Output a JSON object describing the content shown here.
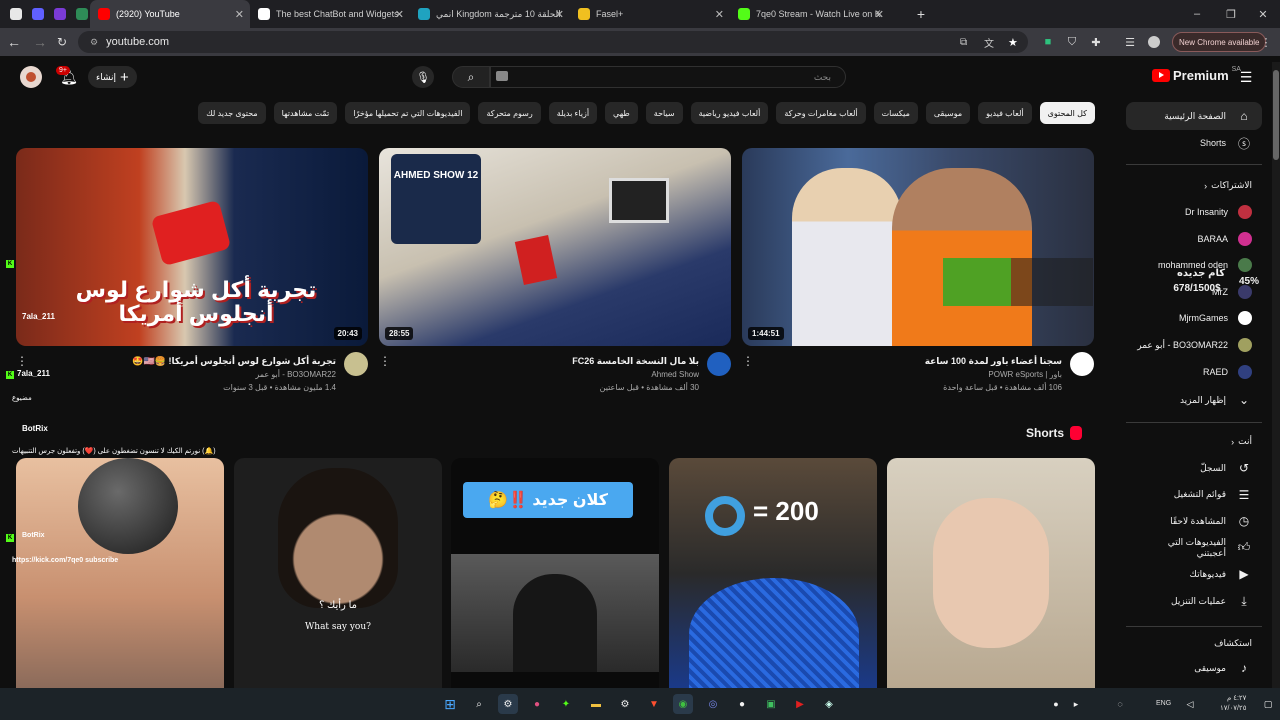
{
  "browser": {
    "tabs": [
      {
        "title": "",
        "color": "#e8e8e8"
      },
      {
        "title": "",
        "color": "#6060ff"
      },
      {
        "title": "",
        "color": "#7a3bd6"
      },
      {
        "title": "",
        "color": "#2e8b57"
      },
      {
        "title": "(2920) YouTube",
        "color": "#ff0000"
      },
      {
        "title": "The best ChatBot and Widgets",
        "color": "#ffffff"
      },
      {
        "title": "انمي Kingdom الحلقة 10 مترجمة",
        "color": "#1fa3c0"
      },
      {
        "title": "Fasel+",
        "color": "#f0c020"
      },
      {
        "title": "7qe0 Stream - Watch Live on K",
        "color": "#53fc18"
      }
    ],
    "new_tab": "+",
    "minimize": "–",
    "restore": "❐",
    "close": "✕",
    "url": "youtube.com",
    "new_chrome_label": "New Chrome available"
  },
  "youtube": {
    "notif_count": "9+",
    "create_label": "إنشاء",
    "search_placeholder": "بحث",
    "logo": "Premium",
    "region": "SA",
    "chips": [
      "كل المحتوى",
      "ألعاب فيديو",
      "موسيقى",
      "ميكسات",
      "ألعاب مغامرات وحركة",
      "ألعاب فيديو رياضية",
      "سياحة",
      "طهي",
      "أزياء بديلة",
      "رسوم متحركة",
      "الفيديوهات التي تم تحميلها مؤخرًا",
      "تمّت مشاهدتها",
      "محتوى جديد لك"
    ],
    "sidebar": {
      "home": "الصفحة الرئيسية",
      "shorts": "Shorts",
      "subs_header": "الاشتراكات",
      "subs": [
        {
          "name": "Dr Insanity",
          "color": "#c03040"
        },
        {
          "name": "BARAA",
          "color": "#d03090"
        },
        {
          "name": "mohammed oden",
          "color": "#4a7a4a"
        },
        {
          "name": "MrZ",
          "color": "#3a3a6a"
        },
        {
          "name": "MjrmGames",
          "color": "#ffffff"
        },
        {
          "name": "BO3OMAR22 - أبو عمر",
          "color": "#a0a060"
        },
        {
          "name": "RAED",
          "color": "#304080"
        }
      ],
      "show_more": "إظهار المزيد",
      "you_header": "أنت",
      "you": [
        {
          "label": "السجلّ",
          "icon": "history-icon"
        },
        {
          "label": "قوائم التشغيل",
          "icon": "playlist-icon"
        },
        {
          "label": "المشاهدة لاحقًا",
          "icon": "clock-icon"
        },
        {
          "label": "الفيديوهات التي أعجبتني",
          "icon": "like-icon"
        },
        {
          "label": "فيديوهاتك",
          "icon": "video-icon"
        },
        {
          "label": "عمليات التنزيل",
          "icon": "download-icon"
        }
      ],
      "explore_header": "استكشاف",
      "music": "موسيقى"
    },
    "videos": [
      {
        "title": "تجربة أكل شوارع لوس أنجلوس أمريكا! 🍔🇺🇸🤩",
        "channel": "BO3OMAR22 - أبو عمر",
        "meta": "1.4 مليون مشاهدة • قبل 3 سنوات",
        "duration": "20:43",
        "thumb_text": "تجربة أكل شوارع لوس أنجلوس أمريكا",
        "avatar": "#c8c090"
      },
      {
        "title": "بلا مال النسخة الخامسة FC26",
        "channel": "Ahmed Show",
        "meta": "30 ألف مشاهدة • قبل ساعتين",
        "duration": "28:55",
        "thumb_text": "AHMED SHOW 12",
        "avatar": "#2060c0"
      },
      {
        "title": "سجنا أعضاء باور لمدة 100 ساعة",
        "channel": "باور | POWR eSports",
        "meta": "106 ألف مشاهدة • قبل ساعة واحدة",
        "duration": "1:44:51",
        "thumb_text": "",
        "avatar": "#ffffff"
      }
    ],
    "shorts_label": "Shorts",
    "shorts": [
      {
        "text": "",
        "bg": "#c89070"
      },
      {
        "text": "ما رأيك ؟",
        "sub": "What say you?",
        "bg": "#2a2a2a"
      },
      {
        "text": "كلان جديد ‼️🤔",
        "bg": "#0a0a0a"
      },
      {
        "text": "= 200",
        "bg": "#3a3a3a"
      },
      {
        "text": "",
        "bg": "#c8b8a0"
      }
    ]
  },
  "overlay": {
    "kick_user": "7ala_211",
    "kick_user2": "7ala_211",
    "msg1": "مضيوع",
    "botrix": "BotRix",
    "botrix_msg": "(🔔) نورتم الكيك لا تنسون تضغطون على (❤️) وتفعلون جرس التنبيهات",
    "botrix2": "BotRix",
    "kick_link": "https://kick.com/7qe0 subscribe",
    "goal_title": "كام جديده",
    "goal_value": "678/1500$",
    "goal_percent": "45%",
    "goal_fill": 0.45
  },
  "taskbar": {
    "lang": "ENG",
    "time": "٤:٢٧ م",
    "date": "١٧/٠٧/٢٥"
  }
}
